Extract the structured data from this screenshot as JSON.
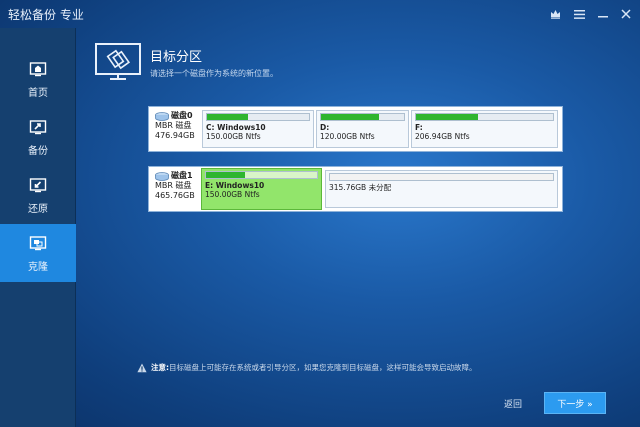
{
  "window": {
    "title": "轻松备份 专业"
  },
  "titlebar": {
    "upgrade_icon": "crown-icon",
    "menu_icon": "hamburger-icon",
    "minimize_icon": "minimize-icon",
    "close_icon": "close-icon"
  },
  "sidebar": {
    "items": [
      {
        "label": "首页",
        "icon": "home-icon",
        "active": false
      },
      {
        "label": "备份",
        "icon": "backup-icon",
        "active": false
      },
      {
        "label": "还原",
        "icon": "restore-icon",
        "active": false
      },
      {
        "label": "克隆",
        "icon": "clone-icon",
        "active": true
      }
    ]
  },
  "header": {
    "title": "目标分区",
    "subtitle": "请选择一个磁盘作为系统的新位置。"
  },
  "disks": [
    {
      "name": "磁盘0",
      "type": "MBR 磁盘",
      "size": "476.94GB",
      "partitions": [
        {
          "name": "C: Windows10",
          "detail": "150.00GB Ntfs",
          "used": 0.4,
          "selected": false
        },
        {
          "name": "D:",
          "detail": "120.00GB Ntfs",
          "used": 0.7,
          "selected": false
        },
        {
          "name": "F:",
          "detail": "206.94GB Ntfs",
          "used": 0.45,
          "selected": false
        }
      ]
    },
    {
      "name": "磁盘1",
      "type": "MBR 磁盘",
      "size": "465.76GB",
      "partitions": [
        {
          "name": "E: Windows10",
          "detail": "150.00GB Ntfs",
          "used": 0.35,
          "selected": true
        },
        {
          "name": "",
          "detail": "315.76GB 未分配",
          "used": 0,
          "selected": false
        }
      ]
    }
  ],
  "note": {
    "prefix": "注意:",
    "text": "目标磁盘上可能存在系统或者引导分区，如果您克隆到目标磁盘，这样可能会导致启动故障。"
  },
  "footer": {
    "back_label": "返回",
    "next_label": "下一步 »"
  },
  "colors": {
    "accent": "#1f88e0",
    "used_bar": "#2fb52f",
    "selected_partition": "#92e56b"
  }
}
